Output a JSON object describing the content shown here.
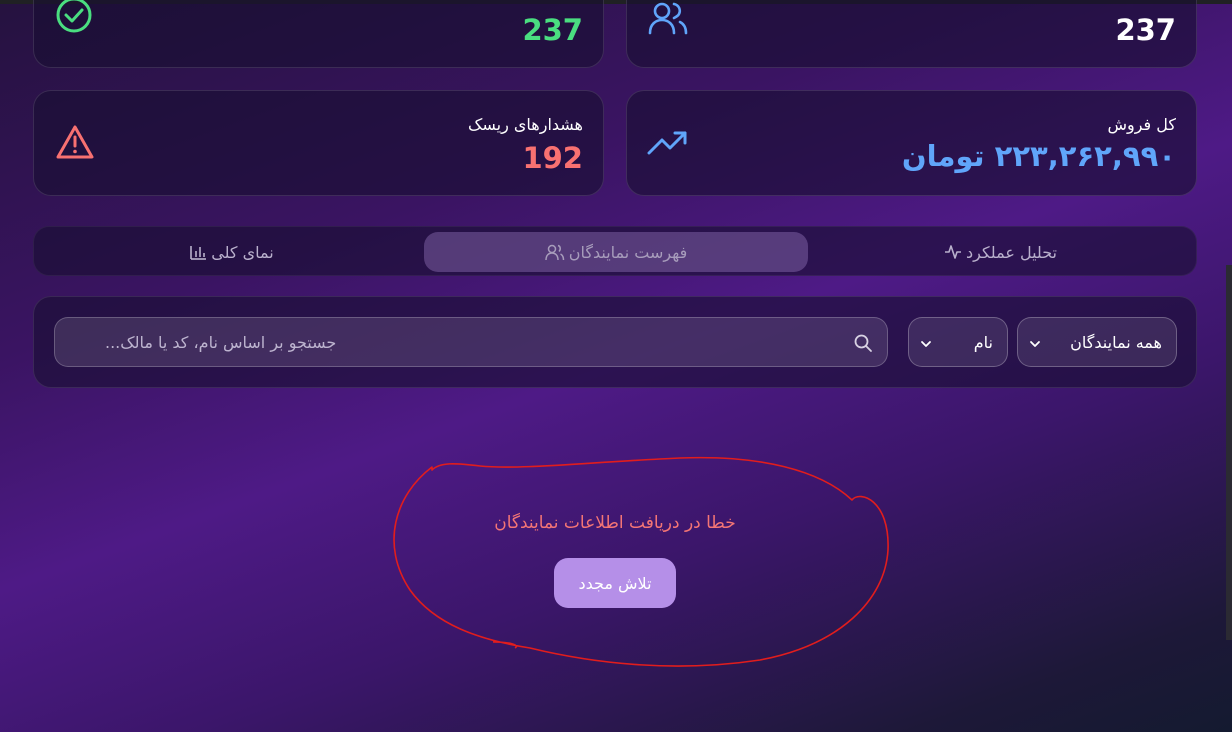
{
  "stats": {
    "active": {
      "value": "237",
      "color": "#4ade80",
      "icon": "check-circle-icon"
    },
    "reps": {
      "value": "237",
      "color": "#ffffff",
      "icon": "users-icon"
    },
    "risk": {
      "label": "هشدارهای ریسک",
      "value": "192",
      "color": "#f87171",
      "icon": "warning-triangle-icon"
    },
    "sales": {
      "label": "کل فروش",
      "value": "۲۲۳,۲۶۲,۹۹۰ تومان",
      "color": "#60a5fa",
      "icon": "trending-up-icon"
    }
  },
  "tabs": [
    {
      "label": "تحلیل عملکرد",
      "icon": "activity-icon",
      "active": false
    },
    {
      "label": "فهرست نمایندگان",
      "icon": "users-icon",
      "active": true
    },
    {
      "label": "نمای کلی",
      "icon": "bar-chart-icon",
      "active": false
    }
  ],
  "filters": {
    "search_placeholder": "جستجو بر اساس نام، کد یا مالک...",
    "status_select": "همه نمایندگان",
    "sort_select": "نام"
  },
  "error": {
    "message": "خطا در دریافت اطلاعات نمایندگان",
    "retry_label": "تلاش مجدد"
  }
}
